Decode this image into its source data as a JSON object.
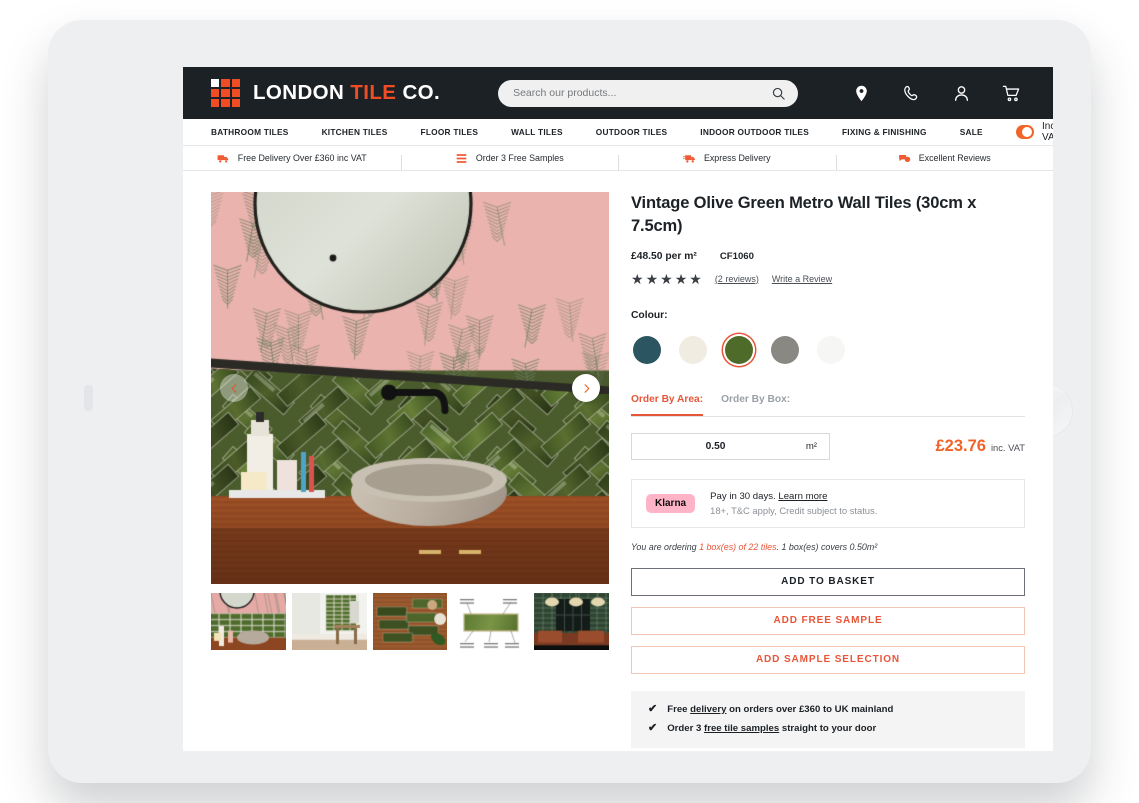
{
  "header": {
    "logo": {
      "primary": "LONDON ",
      "accent": "TILE ",
      "suffix": "CO.",
      "icon_name": "tile-grid-logo"
    },
    "search": {
      "placeholder": "Search our products...",
      "value": "",
      "icon_name": "search-icon"
    },
    "icons": [
      {
        "name": "location-pin-icon",
        "label": "Store Locator"
      },
      {
        "name": "phone-icon",
        "label": "Call Us"
      },
      {
        "name": "user-account-icon",
        "label": "My Account"
      },
      {
        "name": "shopping-cart-icon",
        "label": "Basket"
      }
    ]
  },
  "nav": {
    "items": [
      {
        "label": "BATHROOM TILES"
      },
      {
        "label": "KITCHEN TILES"
      },
      {
        "label": "FLOOR TILES"
      },
      {
        "label": "WALL TILES"
      },
      {
        "label": "OUTDOOR TILES"
      },
      {
        "label": "INDOOR OUTDOOR TILES"
      },
      {
        "label": "FIXING & FINISHING"
      },
      {
        "label": "SALE"
      }
    ],
    "vat_toggle": {
      "label": "Inc. VAT",
      "enabled": true,
      "accent_color": "#f0642a"
    }
  },
  "benefits": [
    {
      "label": "Free Delivery Over £360 inc VAT",
      "icon_name": "delivery-truck-icon"
    },
    {
      "label": "Order 3 Free Samples",
      "icon_name": "samples-stack-icon"
    },
    {
      "label": "Express Delivery",
      "icon_name": "express-truck-icon"
    },
    {
      "label": "Excellent Reviews",
      "icon_name": "review-bubbles-icon"
    }
  ],
  "gallery": {
    "prev_icon": "chevron-left-icon",
    "next_icon": "chevron-right-icon",
    "hero_alt": "Olive green metro tiles herringbone bathroom splashback with stone basin",
    "thumbnails": [
      {
        "alt": "Bathroom basin with green tiles"
      },
      {
        "alt": "Bathroom interior with green tiled wall"
      },
      {
        "alt": "Green metro tiles flat lay on wood"
      },
      {
        "alt": "Tile specification diagram"
      },
      {
        "alt": "Restaurant interior with green tiles"
      }
    ],
    "diagram_labels": [
      "Suitable for walls",
      "Made of ceramic",
      "Rustic distressed glaze effect",
      "Glossy gloss finish",
      "Slight colour variation"
    ]
  },
  "product": {
    "title": "Vintage Olive Green Metro Wall Tiles (30cm x 7.5cm)",
    "unit_price": "£48.50 per m²",
    "sku": "CF1060",
    "rating": 5,
    "reviews_link": "(2 reviews)",
    "write_review_link": "Write a Review",
    "colour": {
      "label": "Colour:",
      "options": [
        {
          "name": "teal",
          "hex": "#2b5561",
          "selected": false
        },
        {
          "name": "cream",
          "hex": "#f1ece1",
          "selected": false
        },
        {
          "name": "olive-green",
          "hex": "#4f6b29",
          "selected": true
        },
        {
          "name": "grey",
          "hex": "#8a8883",
          "selected": false
        },
        {
          "name": "white",
          "hex": "#f6f6f5",
          "selected": false
        }
      ],
      "selected_ring_color": "#e8563a"
    },
    "order_tabs": [
      {
        "label": "Order By Area:",
        "active": true
      },
      {
        "label": "Order By Box:",
        "active": false
      }
    ],
    "quantity": {
      "value": "0.50",
      "unit": "m²"
    },
    "total": {
      "price": "£23.76",
      "vat_note": "inc. VAT"
    },
    "klarna": {
      "badge": "Klarna",
      "line1_text": "Pay in 30 days. ",
      "line1_link": "Learn more",
      "line2": "18+, T&C apply, Credit subject to status."
    },
    "ordering_note": {
      "prefix": "You are ordering ",
      "highlight": "1 box(es) of 22 tiles",
      "suffix": ". 1 box(es) covers 0.50m²"
    },
    "buttons": {
      "add_to_basket": "ADD TO BASKET",
      "add_free_sample": "ADD FREE SAMPLE",
      "add_sample_selection": "ADD SAMPLE SELECTION"
    },
    "delivery_info": [
      {
        "check_icon": "check-icon",
        "pre": "Free ",
        "link": "delivery",
        "post": " on orders over £360 to UK mainland"
      },
      {
        "check_icon": "check-icon",
        "pre": "Order 3 ",
        "link": "free tile samples",
        "post": " straight to your door"
      }
    ]
  },
  "theme": {
    "header_bg": "#1c2126",
    "accent_orange": "#f0642a",
    "link_orange": "#e8563a",
    "klarna_pink": "#ffb3c7",
    "device_frame": "#edeff1"
  }
}
